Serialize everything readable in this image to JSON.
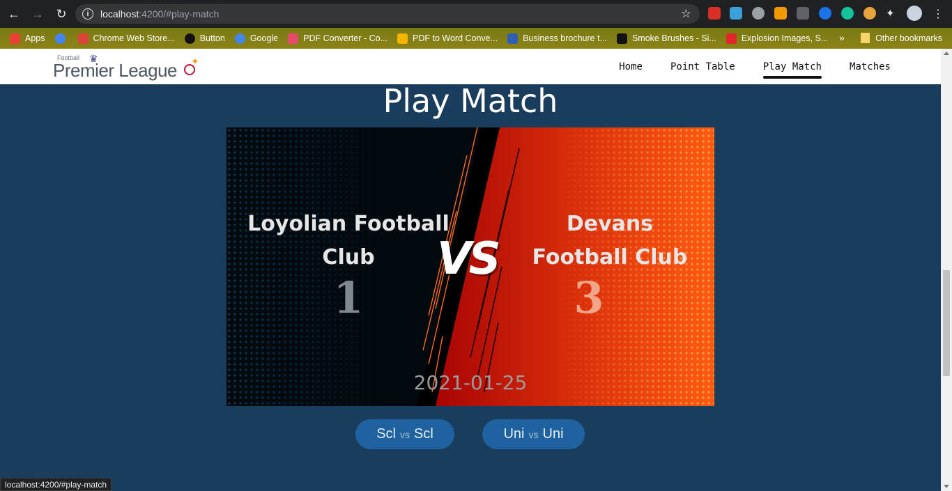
{
  "browser": {
    "url_host": "localhost",
    "url_rest": ":4200/#play-match",
    "bookmarks": [
      {
        "label": "Apps",
        "icon": "apps-grid-icon",
        "color": "#e94235"
      },
      {
        "label": "",
        "icon": "google-icon",
        "color": "#4285f4"
      },
      {
        "label": "Chrome Web Store...",
        "icon": "chrome-web-store-icon",
        "color": "#db4437"
      },
      {
        "label": "Button",
        "icon": "github-icon",
        "color": "#111111"
      },
      {
        "label": "Google",
        "icon": "google-icon",
        "color": "#4285f4"
      },
      {
        "label": "PDF Converter - Co...",
        "icon": "pdf-icon",
        "color": "#e64a69"
      },
      {
        "label": "PDF to Word Conve...",
        "icon": "pdf-word-icon",
        "color": "#f4b400"
      },
      {
        "label": "Business brochure t...",
        "icon": "gear-bookmark-icon",
        "color": "#2f5fb3"
      },
      {
        "label": "Smoke Brushes - Si...",
        "icon": "brush-icon",
        "color": "#111111"
      },
      {
        "label": "Explosion Images, S...",
        "icon": "explosion-icon",
        "color": "#e0262c"
      }
    ],
    "bookmarks_overflow": "»",
    "other_bookmarks": "Other bookmarks",
    "status_url": "localhost:4200/#play-match"
  },
  "site": {
    "logo_small": "Football",
    "logo_big": "Premier League",
    "nav": [
      {
        "label": "Home",
        "active": false
      },
      {
        "label": "Point Table",
        "active": false
      },
      {
        "label": "Play Match",
        "active": true
      },
      {
        "label": "Matches",
        "active": false
      }
    ]
  },
  "page": {
    "title": "Play Match",
    "match": {
      "home_team": "Loyolian Football Club",
      "away_team": "Devans Football Club",
      "home_score": "1",
      "away_score": "3",
      "vs_text": "VS",
      "date": "2021-01-25"
    },
    "other_matches": [
      {
        "home": "Scl",
        "vs": "vs",
        "away": "Scl"
      },
      {
        "home": "Uni",
        "vs": "vs",
        "away": "Uni"
      }
    ]
  },
  "colors": {
    "page_bg": "#1a3d5e",
    "pill_bg": "#1f62a0",
    "banner_left": "#020a10",
    "banner_right": "#ff5a14"
  }
}
